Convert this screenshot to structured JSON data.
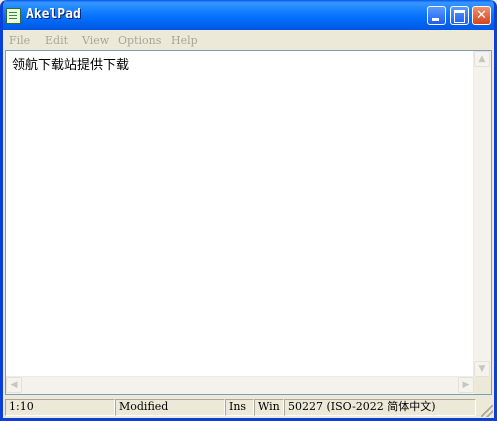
{
  "window": {
    "title": "AkelPad",
    "icon": "notepad-icon"
  },
  "titlebar_buttons": {
    "minimize_icon": "minimize-icon",
    "maximize_icon": "maximize-icon",
    "close_glyph": "✕"
  },
  "menu": {
    "items": [
      {
        "label": "File"
      },
      {
        "label": "Edit"
      },
      {
        "label": "View"
      },
      {
        "label": "Options"
      },
      {
        "label": "Help"
      }
    ]
  },
  "editor": {
    "content": "领航下载站提供下载"
  },
  "scrollbars": {
    "up": "▲",
    "down": "▼",
    "left": "◀",
    "right": "▶"
  },
  "status": {
    "position": "1:10",
    "modified": "Modified",
    "insert_mode": "Ins",
    "line_ending": "Win",
    "encoding": "50227  (ISO-2022 简体中文)"
  },
  "colors": {
    "titlebar": "#0058ee",
    "menu_text_disabled": "#a7a698",
    "frame": "#ece9d8"
  }
}
